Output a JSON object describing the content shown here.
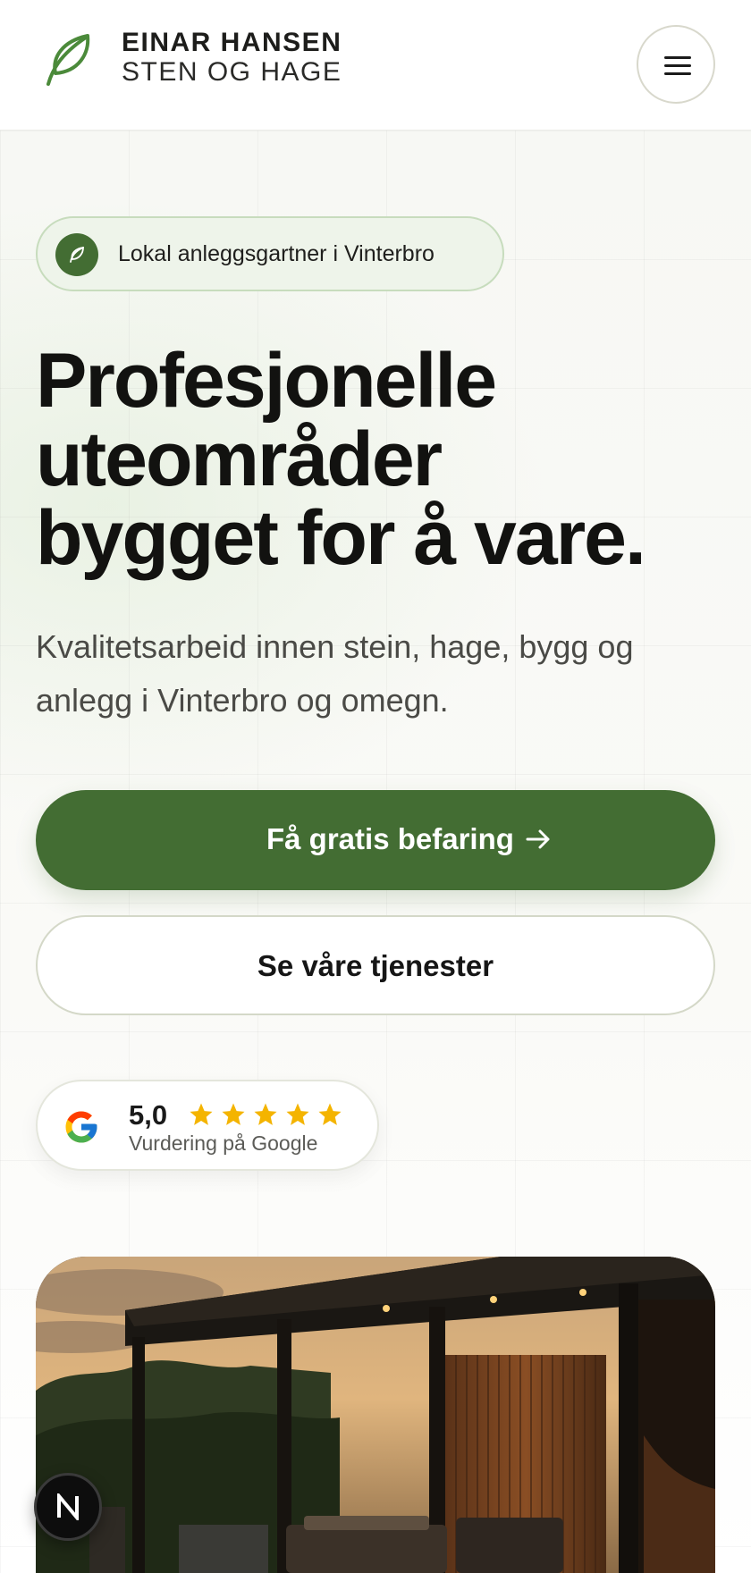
{
  "header": {
    "brand_line1": "EINAR HANSEN",
    "brand_line2": "STEN OG HAGE",
    "logo_icon": "leaf-icon",
    "menu_icon": "hamburger-menu-icon"
  },
  "hero": {
    "badge_text": "Lokal anleggsgartner i Vinterbro",
    "headline_line1": "Profesjonelle",
    "headline_line2": "uteområder",
    "headline_line3": "bygget for å vare.",
    "subtitle": "Kvalitetsarbeid innen stein, hage, bygg og anlegg i Vinterbro og omegn.",
    "cta_primary": "Få gratis befaring",
    "cta_secondary": "Se våre tjenester"
  },
  "rating": {
    "score": "5,0",
    "stars": 5,
    "label": "Vurdering på Google",
    "icon": "google-icon"
  },
  "colors": {
    "brand_green": "#436d33",
    "badge_bg": "#eef4ea",
    "underline": "#b9d2ad",
    "star": "#f4b400"
  }
}
